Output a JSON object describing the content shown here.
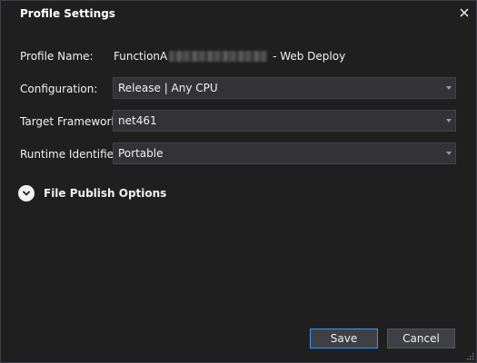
{
  "dialog": {
    "title": "Profile Settings",
    "close_glyph": "✕"
  },
  "fields": {
    "profile_name_label": "Profile Name:",
    "profile_name_prefix": "FunctionA",
    "profile_name_suffix": " - Web Deploy",
    "configuration_label": "Configuration:",
    "configuration_value": "Release | Any CPU",
    "target_framework_label": "Target Framework:",
    "target_framework_value": "net461",
    "runtime_identifier_label": "Runtime Identifier:",
    "runtime_identifier_value": "Portable"
  },
  "expander": {
    "label": "File Publish Options",
    "icon": "chevron-down-icon"
  },
  "buttons": {
    "save": "Save",
    "cancel": "Cancel"
  },
  "colors": {
    "background": "#1f1f1f",
    "input_background": "#333337",
    "primary_border": "#3399ff",
    "text": "#f1f1f1"
  }
}
